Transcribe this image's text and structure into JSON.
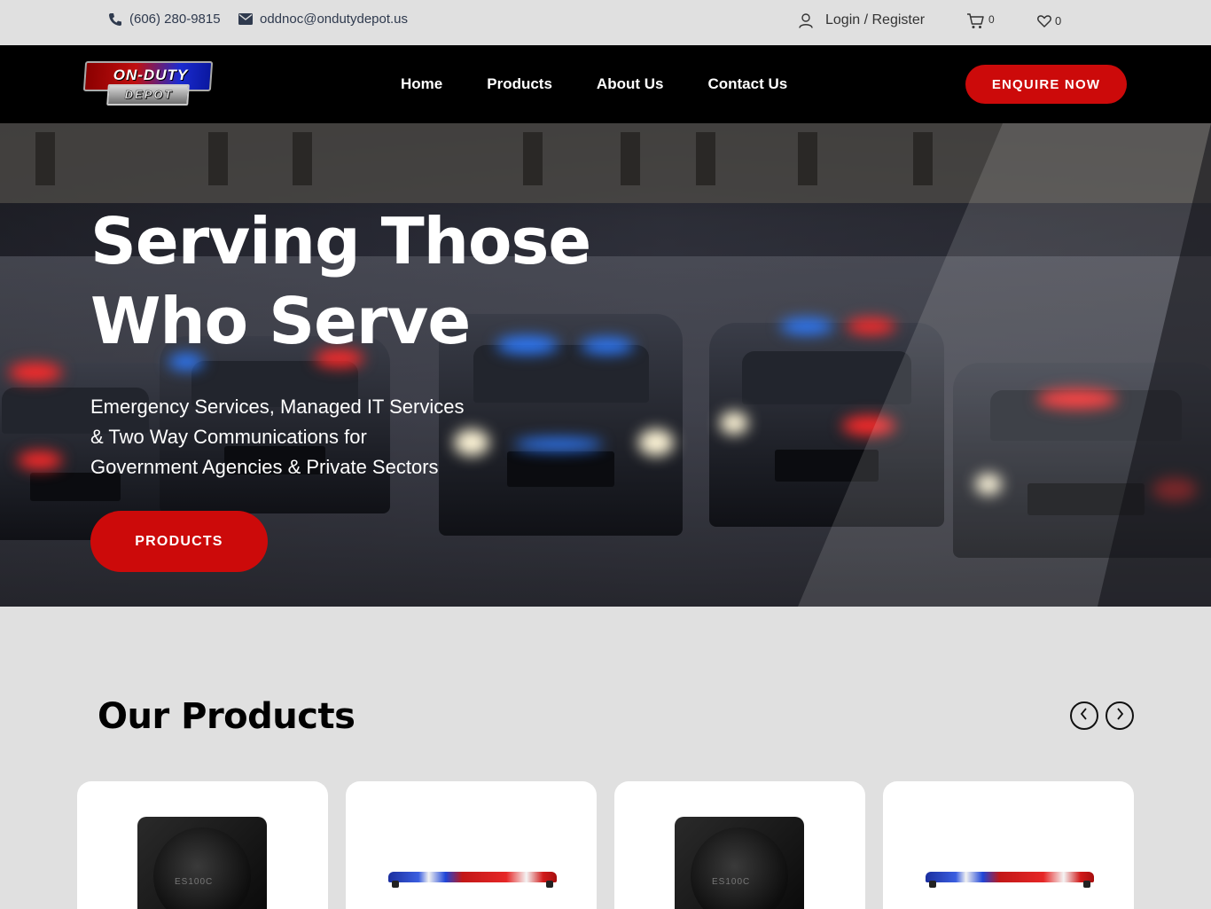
{
  "topbar": {
    "phone": "(606) 280-9815",
    "email": "oddnoc@ondutydepot.us",
    "login": "Login / Register",
    "cart_count": "0",
    "wishlist_count": "0",
    "icons": [
      "phone-icon",
      "envelope-icon",
      "user-icon",
      "cart-icon",
      "heart-icon"
    ]
  },
  "navbar": {
    "logo_line1": "ON-DUTY",
    "logo_line2": "DEPOT",
    "menu": [
      "Home",
      "Products",
      "About Us",
      "Contact Us"
    ],
    "enquire": "ENQUIRE NOW"
  },
  "hero": {
    "title_line1": "Serving Those",
    "title_line2": "Who Serve",
    "subtitle_line1": "Emergency Services, Managed IT Services",
    "subtitle_line2": "& Two Way Communications for",
    "subtitle_line3": "Government Agencies & Private Sectors",
    "cta": "PRODUCTS"
  },
  "products": {
    "title": "Our Products",
    "items": [
      {
        "type": "speaker",
        "brand": "ES100C"
      },
      {
        "type": "lightbar"
      },
      {
        "type": "speaker",
        "brand": "ES100C"
      },
      {
        "type": "lightbar"
      }
    ]
  },
  "colors": {
    "accent": "#cc0a0a",
    "navbar_bg": "#000000",
    "page_bg": "#e0e0e0",
    "topbar_text": "#2f3a4e"
  }
}
